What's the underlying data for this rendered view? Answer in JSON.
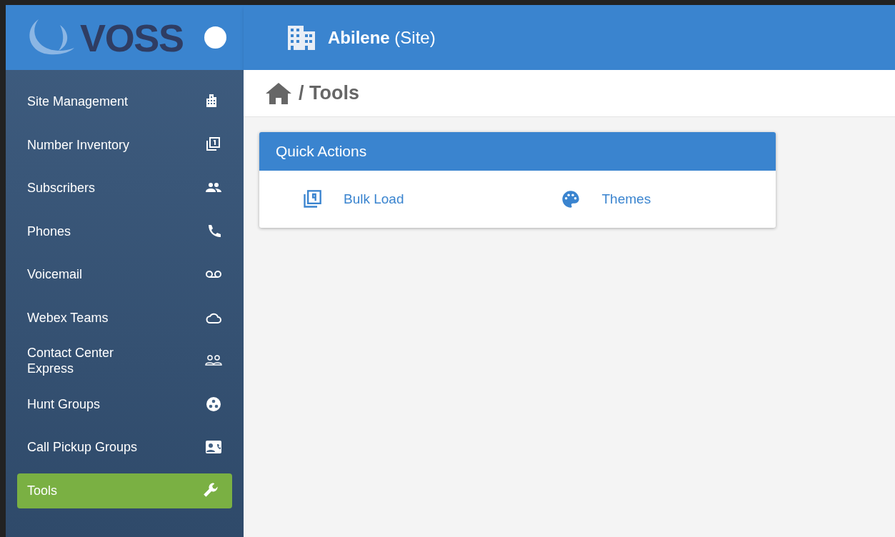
{
  "logo": {
    "text": "VOSS"
  },
  "header": {
    "title": "**Abilene** (Site)"
  },
  "sidebar": {
    "items": [
      {
        "label": "Site Management",
        "selected": false
      },
      {
        "label": "Number Inventory",
        "selected": false
      },
      {
        "label": "Subscribers",
        "selected": false
      },
      {
        "label": "Phones",
        "selected": false
      },
      {
        "label": "Voicemail",
        "selected": false
      },
      {
        "label": "Webex Teams",
        "selected": false
      },
      {
        "label": "Contact Center Express",
        "selected": false
      },
      {
        "label": "Hunt Groups",
        "selected": false
      },
      {
        "label": "Call Pickup Groups",
        "selected": false
      },
      {
        "label": "Tools",
        "selected": true
      }
    ]
  },
  "breadcrumb": {
    "text": "/ Tools"
  },
  "quick_actions": {
    "title": "Quick Actions",
    "actions": [
      {
        "label": "Bulk Load"
      },
      {
        "label": "Themes"
      }
    ]
  }
}
